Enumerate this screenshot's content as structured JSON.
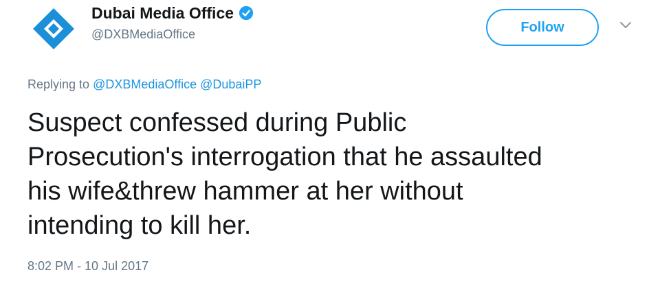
{
  "author": {
    "display_name": "Dubai Media Office",
    "handle": "@DXBMediaOffice",
    "verified": true,
    "avatar_icon": "diamond-logo-icon"
  },
  "follow_button": {
    "label": "Follow"
  },
  "reply": {
    "prefix": "Replying to",
    "mentions": [
      "@DXBMediaOffice",
      "@DubaiPP"
    ]
  },
  "tweet": {
    "lines": [
      "Suspect confessed during Public",
      "Prosecution's interrogation that he assaulted",
      "his wife&threw hammer at her without",
      "intending to kill her."
    ],
    "timestamp": "8:02 PM - 10 Jul 2017"
  },
  "colors": {
    "brand_blue": "#1da1f2",
    "logo_blue": "#1b8fd8",
    "text_primary": "#14171a",
    "text_secondary": "#657786",
    "link": "#1b95e0"
  }
}
